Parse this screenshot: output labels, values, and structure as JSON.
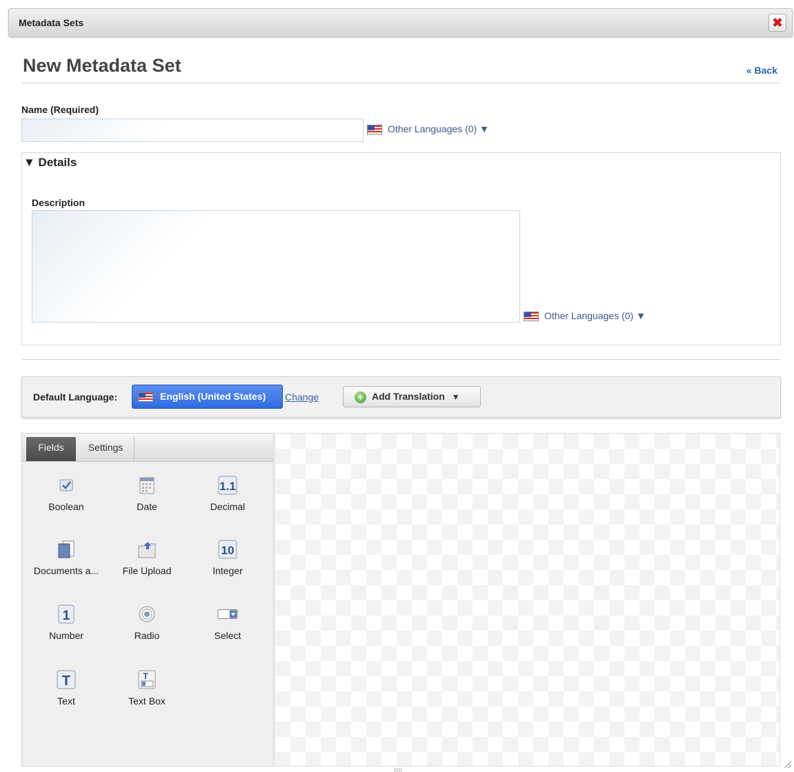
{
  "window": {
    "title": "Metadata Sets",
    "close_label": "✖"
  },
  "header": {
    "title": "New Metadata Set",
    "back_label": "« Back"
  },
  "name_field": {
    "label": "Name (Required)",
    "value": "",
    "other_languages": "Other Languages (0) ▼"
  },
  "details": {
    "toggle_label": "▼ Details",
    "description_label": "Description",
    "description_value": "",
    "other_languages": "Other Languages (0) ▼"
  },
  "language_bar": {
    "label": "Default Language:",
    "language": "English (United States)",
    "change_label": "Change",
    "add_translation_label": "Add Translation",
    "add_translation_caret": "▼"
  },
  "panel": {
    "tabs": [
      {
        "label": "Fields",
        "active": true
      },
      {
        "label": "Settings",
        "active": false
      }
    ],
    "fields": [
      {
        "label": "Boolean",
        "icon": "checkbox-icon"
      },
      {
        "label": "Date",
        "icon": "calendar-icon"
      },
      {
        "label": "Decimal",
        "icon": "decimal-icon"
      },
      {
        "label": "Documents a...",
        "icon": "documents-icon"
      },
      {
        "label": "File Upload",
        "icon": "file-upload-icon"
      },
      {
        "label": "Integer",
        "icon": "integer-icon"
      },
      {
        "label": "Number",
        "icon": "number-icon"
      },
      {
        "label": "Radio",
        "icon": "radio-icon"
      },
      {
        "label": "Select",
        "icon": "select-icon"
      },
      {
        "label": "Text",
        "icon": "text-icon"
      },
      {
        "label": "Text Box",
        "icon": "text-box-icon"
      }
    ]
  },
  "colors": {
    "primary_button": "#3a78e8",
    "link": "#2a62a8",
    "close": "#d11a1a"
  }
}
